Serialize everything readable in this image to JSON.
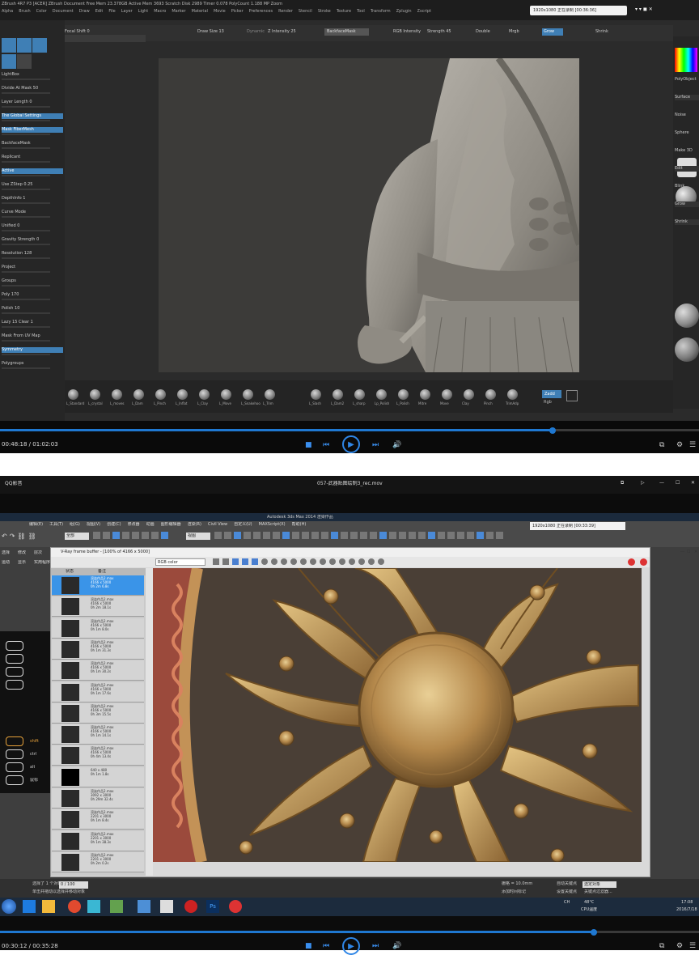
{
  "player_top": {
    "zbrush": {
      "menubar": "ZBrush 4R7 P3 [ACER]   ZBrush Document   Free Mem 23.378GB   Active Mem 3693   Scratch Disk 2989   Timer 0.078   PolyCount 1.188 MP   Zoom",
      "menu_items": [
        "Alpha",
        "Brush",
        "Color",
        "Document",
        "Draw",
        "Edit",
        "File",
        "Layer",
        "Light",
        "Macro",
        "Marker",
        "Material",
        "Movie",
        "Picker",
        "Preferences",
        "Render",
        "Stencil",
        "Stroke",
        "Texture",
        "Tool",
        "Transform",
        "Zplugin",
        "Zscript"
      ],
      "top_controls": {
        "focal_shift": "Focal Shift 0",
        "draw_size": "Draw Size 13",
        "dynamic": "Dynamic",
        "z_intensity": "Z Intensity 25",
        "backfacemask": "BackfaceMask",
        "rgb_label": "RGB Intensity",
        "strength": "Strength 45",
        "double": "Double",
        "mrgb": "Mrgb",
        "grow": "Grow",
        "shrink": "Shrink"
      },
      "capture_badge": "1920x1080 正在录制 [00:36:36]",
      "left_panel": [
        "LightBox",
        "Divide At Mask 50",
        "Layer Length 0",
        "The Global Settings",
        "Mask FiberMesh",
        "BackfaceMask",
        "Replicant",
        "Active",
        "Use ZStep 0.25",
        "DepthInfo 1",
        "Curve Mode",
        "Unified 0",
        "Gravity Strength 0",
        "Resolution 128",
        "Project",
        "Groups",
        "Poly 170",
        "Polish 10",
        "Lazy 15 Clear 1",
        "Mask From UV Map",
        "Symmetry",
        "Polygroups"
      ],
      "right_panel": [
        "PolyObject",
        "Surface",
        "Noise",
        "Sphere",
        "Make 3D",
        "Edit",
        "Blink",
        "Grow",
        "Shrink"
      ],
      "brushes": [
        "L_Standard",
        "L_crystal",
        "L_moves",
        "L_Dam",
        "L_Pinch",
        "L_Inflat",
        "L_Clay",
        "L_Move",
        "L_Snakehook",
        "L_Trim",
        "L_Slash",
        "L_Dam2",
        "L_sharp",
        "Lp_Polish",
        "L_Polish",
        "Mitre",
        "Move",
        "Clay",
        "Pinch",
        "TrimAdp"
      ],
      "zadd": "Zadd",
      "rgb": "Rgb"
    },
    "controls": {
      "time": "00:48:18 / 01:02:03",
      "progress": 0.79
    }
  },
  "player_bottom": {
    "app_title": "QQ影音",
    "file_name": "057-武器贴图绘制3_rec.mov",
    "max": {
      "title": "Autodesk 3ds Max 2014   渲染作品",
      "menus": [
        "编辑(E)",
        "工具(T)",
        "组(G)",
        "视图(V)",
        "创建(C)",
        "修改器",
        "动画",
        "图形编辑器",
        "渲染(R)",
        "Civil View",
        "自定义(U)",
        "MAXScript(X)",
        "帮助(H)"
      ],
      "capture_badge": "1920x1080 正在录制 [00:33:39]",
      "selection_dropdown": "全部",
      "view_dropdown": "视图",
      "vfb_title": "V-Ray frame buffer - [100% of 4166 x 5000]",
      "channel": "RGB color",
      "history_header": [
        "状态",
        "备注"
      ],
      "history": [
        [
          "渲染作品2.max",
          "4166 x 5000",
          "0h 2m 6.8s"
        ],
        [
          "渲染作品2.max",
          "4166 x 5000",
          "0h 2m 18.1s"
        ],
        [
          "渲染作品2.max",
          "4166 x 5000",
          "0h 1m 8.0s"
        ],
        [
          "渲染作品2.max",
          "4166 x 5000",
          "0h 1m 31.3s"
        ],
        [
          "渲染作品2.max",
          "4166 x 5000",
          "0h 1m 30.2s"
        ],
        [
          "渲染作品2.max",
          "4166 x 5000",
          "0h 1m 17.6s"
        ],
        [
          "渲染作品2.max",
          "4166 x 5000",
          "0h 3m 15.5s"
        ],
        [
          "渲染作品2.max",
          "4166 x 5000",
          "0h 1m 14.1s"
        ],
        [
          "渲染作品2.max",
          "4166 x 5000",
          "0h 4m 13.4s"
        ],
        [
          "640 x 480",
          "0h 1m 1.8s",
          ""
        ],
        [
          "渲染作品2.max",
          "3092 x 3000",
          "0h 29m 32.4s"
        ],
        [
          "渲染作品2.max",
          "2201 x 3000",
          "0h 1m 8.4s"
        ],
        [
          "渲染作品2.max",
          "2201 x 3000",
          "0h 1m 38.3s"
        ],
        [
          "渲染作品2.max",
          "2201 x 3000",
          "0h 2m 0.2s"
        ]
      ],
      "overlay_keys": [
        "shift",
        "ctrl",
        "alt",
        "鼠标"
      ],
      "left_labels": [
        "选择",
        "修改",
        "层次",
        "运动",
        "显示",
        "实用程序"
      ],
      "status_left": "选择了 1 个对象",
      "status_hint": "单击并拖动以选择并移动对象",
      "frame_counter": "0 / 100",
      "grid": "栅格 = 10.0mm",
      "add_time_tag": "添加时间标记",
      "auto_key": "自动关键点",
      "set_key": "设置关键点",
      "key_filter": "选定对象",
      "key_filters_btn": "关键点过滤器..."
    },
    "taskbar": {
      "cpu": "CPU温度",
      "temp": "48°C",
      "time": "17:08",
      "date": "2016/7/18",
      "lang": "CH"
    },
    "controls": {
      "time": "00:30:12 / 00:35:28",
      "progress": 0.85
    }
  }
}
